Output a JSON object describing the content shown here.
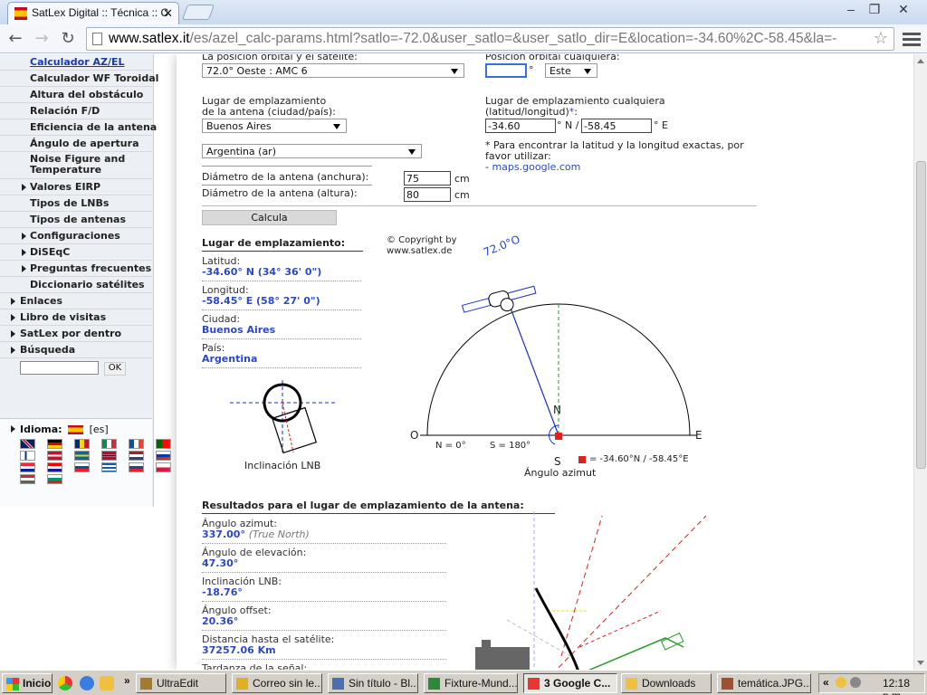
{
  "browser": {
    "tab_title": "SatLex Digital :: Técnica :: C",
    "url_host": "www.satlex.it",
    "url_rest": "/es/azel_calc-params.html?satlo=-72.0&user_satlo=&user_satlo_dir=E&location=-34.60%2C-58.45&la=-",
    "colors": {
      "accent": "#2b49c7",
      "link": "#1a3aa8",
      "satline": "#1a2fc2",
      "red": "#e02020"
    }
  },
  "sidebar": {
    "items": [
      {
        "label": "Calculador AZ/EL",
        "type": "active"
      },
      {
        "label": "Calculador WF Toroidal",
        "type": "sub"
      },
      {
        "label": "Altura del obstáculo",
        "type": "sub"
      },
      {
        "label": "Relación F/D",
        "type": "sub"
      },
      {
        "label": "Eficiencia de la antena",
        "type": "sub"
      },
      {
        "label": "Ángulo de apertura",
        "type": "sub"
      },
      {
        "label": "Noise Figure and Temperature",
        "type": "tall"
      },
      {
        "label": "Valores EIRP",
        "type": "arrow"
      },
      {
        "label": "Tipos de LNBs",
        "type": "sub"
      },
      {
        "label": "Tipos de antenas",
        "type": "sub"
      },
      {
        "label": "Configuraciones",
        "type": "arrow"
      },
      {
        "label": "DiSEqC",
        "type": "arrow"
      },
      {
        "label": "Preguntas frecuentes",
        "type": "arrow"
      },
      {
        "label": "Diccionario satélites",
        "type": "sub"
      },
      {
        "label": "Enlaces",
        "type": "l1"
      },
      {
        "label": "Libro de visitas",
        "type": "l1"
      },
      {
        "label": "SatLex por dentro",
        "type": "l1"
      },
      {
        "label": "Búsqueda",
        "type": "l1"
      }
    ],
    "ok": "OK",
    "language_label": "Idioma:",
    "language_code": "[es]"
  },
  "form": {
    "orbital_label": "La posición orbital y el satélite:",
    "orbital_value": "72.0° Oeste : AMC 6",
    "orbital_any_label": "Posición orbital cualquiera:",
    "orbital_any_unit": "°",
    "orbital_any_dir": "Este",
    "site_label_1": "Lugar de emplazamiento",
    "site_label_2": "de la antena (ciudad/país):",
    "city_value": "Buenos Aires",
    "country_value": "Argentina (ar)",
    "any_site_label": "Lugar de emplazamiento cualquiera",
    "any_site_label_2": "(latitud/longitud)",
    "asterisk": "*",
    "lat_value": "-34.60",
    "lat_unit": "° N /",
    "lon_value": "-58.45",
    "lon_unit": "° E",
    "note_1": "* Para encontrar la latitud y la longitud exactas, por",
    "note_2": "favor utilizar:",
    "note_3_prefix": "- ",
    "note_3_link": "maps.google.com",
    "width_label": "Diámetro de la antena (anchura):",
    "width_value": "75",
    "height_label": "Diámetro de la antena (altura):",
    "height_value": "80",
    "unit_cm": "cm",
    "calc_button": "Calcula"
  },
  "site": {
    "header": "Lugar de emplazamiento:",
    "lat_key": "Latitud:",
    "lat_val": "-34.60° N (34° 36' 0\")",
    "lon_key": "Longitud:",
    "lon_val": "-58.45° E (58° 27' 0\")",
    "city_key": "Ciudad:",
    "city_val": "Buenos Aires",
    "country_key": "País:",
    "country_val": "Argentina"
  },
  "diagram": {
    "copyright_1": "© Copyright by",
    "copyright_2": "www.satlex.de",
    "sat_angle": "72.0°O",
    "n": "N",
    "s": "S",
    "o": "O",
    "e": "E",
    "n0": "N = 0°",
    "s180": "S = 180°",
    "coords": "= -34.60°N / -58.45°E",
    "azimuth_caption": "Ángulo azimut",
    "lnb_caption": "Inclinación LNB"
  },
  "results": {
    "header": "Resultados para el lugar de emplazamiento de la antena:",
    "az_key": "Ángulo azimut:",
    "az_val": "337.00°",
    "az_note": "(True North)",
    "el_key": "Ángulo de elevación:",
    "el_val": "47.30°",
    "lnb_key": "Inclinación LNB:",
    "lnb_val": "-18.76°",
    "off_key": "Ángulo offset:",
    "off_val": "20.36°",
    "dist_key": "Distancia hasta el satélite:",
    "dist_val": "37257.06 Km",
    "delay_key": "Tardanza de la señal:"
  },
  "taskbar": {
    "start": "Inicio",
    "tasks": [
      "UltraEdit",
      "Correo sin le...",
      "Sin título - Bl...",
      "Fixture-Mund...",
      "3 Google C...",
      "Downloads",
      "temática.JPG..."
    ],
    "clock": "12:18 p.m."
  }
}
